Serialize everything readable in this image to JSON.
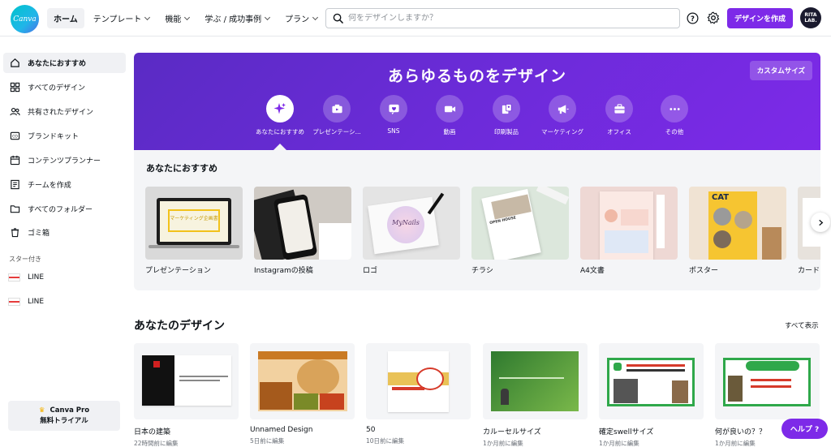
{
  "brand": {
    "logo_text": "Canva",
    "accent": "#7d2ae8",
    "teal": "#00c4cc"
  },
  "nav": {
    "items": [
      {
        "label": "ホーム",
        "active": true
      },
      {
        "label": "テンプレート"
      },
      {
        "label": "機能"
      },
      {
        "label": "学ぶ / 成功事例"
      },
      {
        "label": "プラン"
      }
    ]
  },
  "search": {
    "placeholder": "何をデザインしますか？"
  },
  "header": {
    "create_label": "デザインを作成",
    "avatar_line1": "RITA",
    "avatar_line2": "LAB."
  },
  "sidebar": {
    "items": [
      {
        "label": "あなたにおすすめ",
        "icon": "home-icon"
      },
      {
        "label": "すべてのデザイン",
        "icon": "grid-icon"
      },
      {
        "label": "共有されたデザイン",
        "icon": "people-icon"
      },
      {
        "label": "ブランドキット",
        "icon": "brand-icon"
      },
      {
        "label": "コンテンツプランナー",
        "icon": "calendar-icon"
      },
      {
        "label": "チームを作成",
        "icon": "team-icon"
      },
      {
        "label": "すべてのフォルダー",
        "icon": "folder-icon"
      },
      {
        "label": "ゴミ箱",
        "icon": "trash-icon"
      }
    ],
    "starred_title": "スター付き",
    "starred": [
      {
        "label": "LINE"
      },
      {
        "label": "LINE"
      }
    ],
    "pro_line1": "Canva Pro",
    "pro_line2": "無料トライアル"
  },
  "hero": {
    "title": "あらゆるものをデザイン",
    "custom_size": "カスタムサイズ",
    "categories": [
      {
        "label": "あなたにおすすめ",
        "icon": "sparkle-icon"
      },
      {
        "label": "プレゼンテーシ...",
        "icon": "presentation-icon"
      },
      {
        "label": "SNS",
        "icon": "heart-icon"
      },
      {
        "label": "動画",
        "icon": "video-icon"
      },
      {
        "label": "印刷製品",
        "icon": "print-icon"
      },
      {
        "label": "マーケティング",
        "icon": "megaphone-icon"
      },
      {
        "label": "オフィス",
        "icon": "briefcase-icon"
      },
      {
        "label": "その他",
        "icon": "more-icon"
      }
    ]
  },
  "recommend": {
    "title": "あなたにおすすめ",
    "cards": [
      {
        "label": "プレゼンテーション",
        "thumb_text": "マーケティング企画書"
      },
      {
        "label": "Instagramの投稿",
        "thumb_text": ""
      },
      {
        "label": "ロゴ",
        "thumb_text": "MyNails"
      },
      {
        "label": "チラシ",
        "thumb_text": "OPEN HOUSE"
      },
      {
        "label": "A4文書",
        "thumb_text": ""
      },
      {
        "label": "ポスター",
        "thumb_text": "CAT"
      },
      {
        "label": "カード",
        "thumb_text": ""
      }
    ]
  },
  "your_designs": {
    "title": "あなたのデザイン",
    "see_all": "すべて表示",
    "items": [
      {
        "name": "日本の建築",
        "time": "22時間前に編集"
      },
      {
        "name": "Unnamed Design",
        "time": "5日前に編集"
      },
      {
        "name": "50",
        "time": "10日前に編集"
      },
      {
        "name": "カルーセルサイズ",
        "time": "1か月前に編集"
      },
      {
        "name": "確定swellサイズ",
        "time": "1か月前に編集"
      },
      {
        "name": "何が良いの？？",
        "time": "1か月前に編集"
      }
    ]
  },
  "help_label": "ヘルプ ?"
}
